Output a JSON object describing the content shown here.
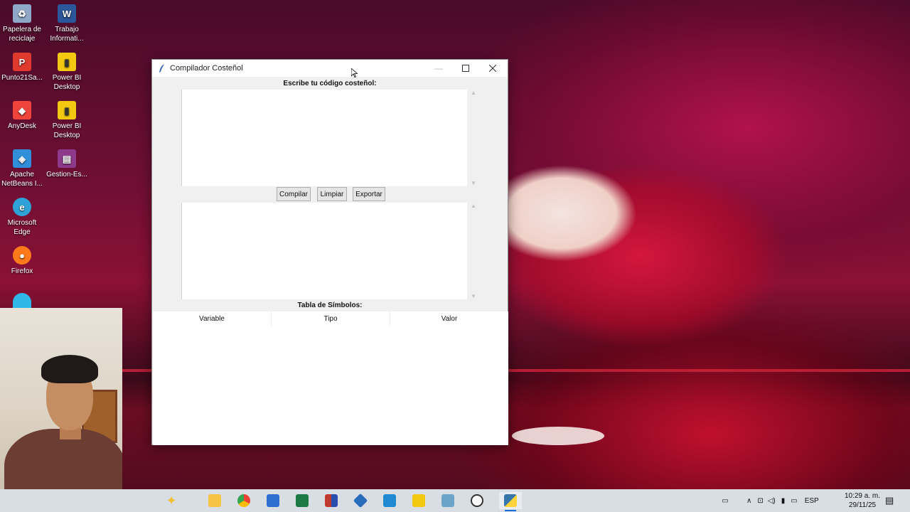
{
  "desktop": {
    "icons": [
      {
        "label": "Papelera de reciclaje",
        "icon": "recycle-bin-icon",
        "color": "#8fa8c8"
      },
      {
        "label": "Trabajo Informati...",
        "icon": "word-document-icon",
        "color": "#2b579a"
      },
      {
        "label": "Punto21Sa...",
        "icon": "pdf-icon",
        "color": "#e03a2e"
      },
      {
        "label": "Power BI Desktop",
        "icon": "power-bi-icon",
        "color": "#f2c811"
      },
      {
        "label": "AnyDesk",
        "icon": "anydesk-icon",
        "color": "#ef443b"
      },
      {
        "label": "Power BI Desktop",
        "icon": "power-bi-icon",
        "color": "#f2c811"
      },
      {
        "label": "Apache NetBeans I...",
        "icon": "netbeans-icon",
        "color": "#2f8fd8"
      },
      {
        "label": "Gestion-Es...",
        "icon": "winrar-archive-icon",
        "color": "#8e3a8c"
      },
      {
        "label": "Microsoft Edge",
        "icon": "edge-icon",
        "color": "#2fa3d7"
      },
      {
        "label": "Firefox",
        "icon": "firefox-icon",
        "color": "#ff7a1a"
      }
    ]
  },
  "window": {
    "title": "Compilador Costeñol",
    "code_label": "Escribe tu código costeñol:",
    "buttons": {
      "compile": "Compilar",
      "clear": "Limpiar",
      "export": "Exportar"
    },
    "symbols_label": "Tabla de Símbolos:",
    "table_headers": [
      "Variable",
      "Tipo",
      "Valor"
    ]
  },
  "taskbar": {
    "apps": [
      {
        "icon": "copilot-icon",
        "color": "#f2c230"
      },
      {
        "icon": "file-explorer-icon",
        "color": "#f6c344"
      },
      {
        "icon": "chrome-icon",
        "color": "#4285f4"
      },
      {
        "icon": "microsoft-store-icon",
        "color": "#2f6fd0"
      },
      {
        "icon": "excel-icon",
        "color": "#1d7a44"
      },
      {
        "icon": "app-icon",
        "color": "#c03a2e"
      },
      {
        "icon": "virtualbox-icon",
        "color": "#2a6ebb"
      },
      {
        "icon": "vscode-icon",
        "color": "#1f8ad2"
      },
      {
        "icon": "power-bi-icon",
        "color": "#f2c811"
      },
      {
        "icon": "notepad-icon",
        "color": "#6aa5c7"
      },
      {
        "icon": "speedometer-icon",
        "color": "#333333"
      },
      {
        "icon": "python-icon",
        "color": "#3776ab"
      }
    ],
    "language": "ESP",
    "time": "10:29 a. m.",
    "date": "29/11/25"
  }
}
